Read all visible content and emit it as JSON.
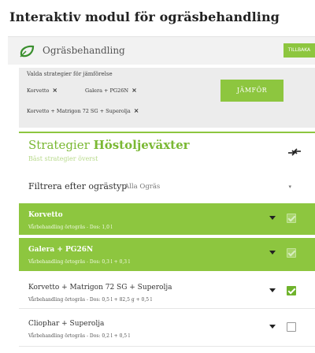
{
  "page": {
    "title": "Interaktiv modul för ogräsbehandling"
  },
  "module": {
    "name": "Ogräsbehandling",
    "back_label": "TILLBAKA"
  },
  "comparison": {
    "label": "Valda strategier för jämförelse",
    "chips": [
      {
        "label": "Korvetto"
      },
      {
        "label": "Galera + PG26N"
      },
      {
        "label": "Korvetto + Matrigon 72 SG + Superolja"
      }
    ],
    "compare_label": "JÄMFÖR"
  },
  "strategies": {
    "title_part1": "Strategier",
    "title_part2": "Höstoljeväxter",
    "subtitle": "Bäst strategier överst"
  },
  "filter": {
    "label": "Filtrera efter ogrästyp",
    "value": "Alla Ogräs"
  },
  "items": [
    {
      "name": "Korvetto",
      "desc": "Vårbehandling örtogräs - Dos: 1,0 l",
      "selected": true
    },
    {
      "name": "Galera + PG26N",
      "desc": "Vårbehandling örtogräs - Dos: 0,3 l + 0,3 l",
      "selected": true
    },
    {
      "name": "Korvetto + Matrigon 72 SG + Superolja",
      "desc": "Vårbehandling örtogräs - Dos: 0,5 l + 82,5 g + 0,5 l",
      "selected": true
    },
    {
      "name": "Cliophar + Superolja",
      "desc": "Vårbehandling örtogräs - Dos: 0,2 l + 0,5 l",
      "selected": false
    }
  ],
  "colors": {
    "accent": "#8dc63f",
    "accent_light": "#b7d98a"
  }
}
